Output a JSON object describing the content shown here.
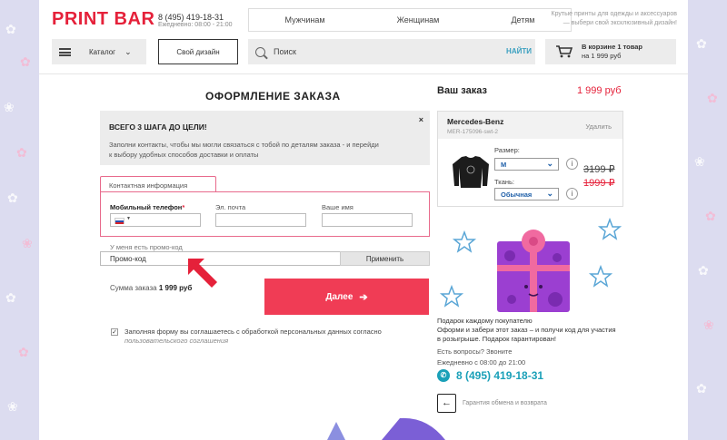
{
  "header": {
    "logo": "PRINT BAR",
    "phone": "8 (495) 419-18-31",
    "hours": "Ежедневно: 08:00 - 21:00",
    "nav": [
      "Мужчинам",
      "Женщинам",
      "Детям"
    ],
    "slogan": "Крутые принты для одежды и аксессуаров — выбери свой эксклюзивный дизайн!",
    "catalog_label": "Каталог",
    "own_design_label": "Свой дизайн",
    "search_placeholder": "Поиск",
    "search_button": "НАЙТИ",
    "cart_line1": "В корзине 1 товар",
    "cart_line2": "на 1 999 руб"
  },
  "checkout": {
    "title": "ОФОРМЛЕНИЕ ЗАКАЗА",
    "steps_title": "ВСЕГО 3 ШАГА ДО ЦЕЛИ!",
    "steps_text": "Заполни контакты, чтобы мы могли связаться с тобой по деталям заказа - и перейди к выбору удобных способов доставки и оплаты",
    "close_glyph": "×",
    "contact_tab": "Контактная информация",
    "mobile_label": "Мобильный телефон",
    "mobile_required": "*",
    "email_label": "Эл. почта",
    "name_label": "Ваше имя",
    "promo_question": "У меня есть промо-код",
    "promo_placeholder": "Промо-код",
    "apply_label": "Применить",
    "sum_label": "Сумма заказа",
    "sum_value": "1 999 руб",
    "next_label": "Далее",
    "next_arrow": "➔",
    "agree_text": "Заполняя форму вы соглашаетесь с обработкой персональных данных согласно",
    "agree_link": "пользовательского соглашения",
    "agree_checked": "✓"
  },
  "order": {
    "title": "Ваш заказ",
    "total": "1 999 руб",
    "item_name": "Mercedes-Benz",
    "item_sku": "MER-175096-swt-2",
    "delete_label": "Удалить",
    "size_label": "Размер:",
    "size_value": "M",
    "fabric_label": "Ткань:",
    "fabric_value": "Обычная",
    "info_glyph": "i",
    "old_price": "3199 ₽",
    "new_price": "1999 ₽",
    "gift_line1": "Подарок каждому покупателю",
    "gift_line2": "Оформи и забери этот заказ – и получи код для участия",
    "gift_line3": "в розыгрыше. Подарок гарантирован!",
    "questions": "Есть вопросы? Звоните",
    "hours": "Ежедневно с 08:00 до 21:00",
    "phone": "8 (495) 419-18-31",
    "exchange": "Гарантия обмена и возврата"
  },
  "colors": {
    "brand_red": "#e5213a",
    "accent_teal": "#1aa0b8",
    "gift_purple": "#9b3fd1",
    "ribbon_pink": "#f06aa0"
  }
}
